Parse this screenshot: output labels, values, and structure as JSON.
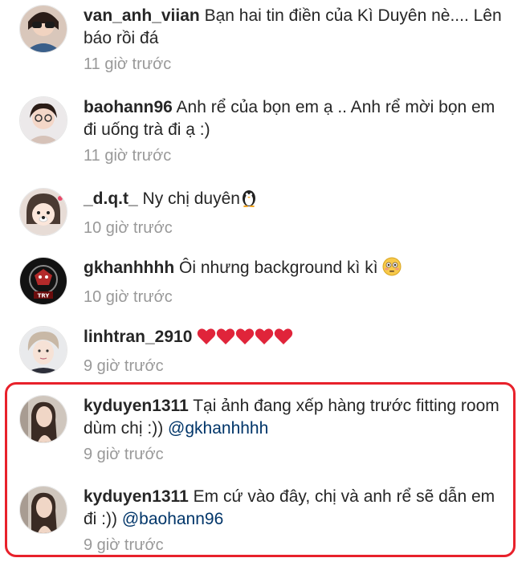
{
  "comments": [
    {
      "username": "van_anh_viian",
      "text": "Bạn hai tin điền của Kì Duyên nè.... Lên báo rồi đá",
      "mention": "",
      "time": "11 giờ trước"
    },
    {
      "username": "baohann96",
      "text": "Anh rể của bọn em ạ .. Anh rể mời bọn em đi uống trà đi ạ :)",
      "mention": "",
      "time": "11 giờ trước"
    },
    {
      "username": "_d.q.t_",
      "text": "Ny chị duyên",
      "mention": "",
      "time": "10 giờ trước"
    },
    {
      "username": "gkhanhhhh",
      "text": "Ôi nhưng background kì kì",
      "mention": "",
      "time": "10 giờ trước"
    },
    {
      "username": "linhtran_2910",
      "text": "",
      "mention": "",
      "time": "9 giờ trước"
    },
    {
      "username": "kyduyen1311",
      "text": "Tại ảnh đang xếp hàng trước fitting room dùm chị :))",
      "mention": "@gkhanhhhh",
      "time": "9 giờ trước"
    },
    {
      "username": "kyduyen1311",
      "text": "Em cứ vào đây, chị và anh rể sẽ dẫn em đi :))",
      "mention": "@baohann96",
      "time": "9 giờ trước"
    }
  ],
  "icons": {
    "penguin": "penguin-emoji-icon",
    "flushed": "flushed-face-emoji-icon",
    "heart": "red-heart-emoji-icon"
  },
  "colors": {
    "highlight": "#e8212b",
    "mention": "#003569",
    "timestamp": "#999999"
  }
}
